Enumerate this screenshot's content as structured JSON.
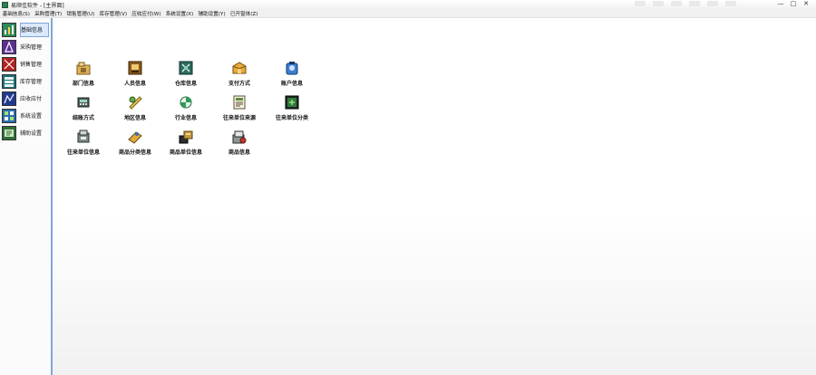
{
  "window": {
    "title": "易顺佳软件 - [主界面]",
    "controls": [
      "—",
      "□",
      "✕"
    ]
  },
  "menu": [
    "基础信息(S)",
    "采购管理(T)",
    "销售管理(U)",
    "库存管理(V)",
    "应收应付(W)",
    "系统设置(X)",
    "辅助设置(Y)",
    "已开窗体(Z)"
  ],
  "sidebar": {
    "items": [
      {
        "label": "基础信息",
        "icon": "folder-chart-icon",
        "active": true
      },
      {
        "label": "采购管理",
        "icon": "purchase-icon",
        "active": false
      },
      {
        "label": "销售管理",
        "icon": "sales-icon",
        "active": false
      },
      {
        "label": "库存管理",
        "icon": "inventory-icon",
        "active": false
      },
      {
        "label": "应收应付",
        "icon": "receivable-icon",
        "active": false
      },
      {
        "label": "系统设置",
        "icon": "settings-icon",
        "active": false
      },
      {
        "label": "辅助设置",
        "icon": "aux-settings-icon",
        "active": false
      }
    ]
  },
  "tiles": [
    {
      "label": "部门信息",
      "icon": "department-icon"
    },
    {
      "label": "人员信息",
      "icon": "staff-icon"
    },
    {
      "label": "仓库信息",
      "icon": "warehouse-icon"
    },
    {
      "label": "支付方式",
      "icon": "payment-icon"
    },
    {
      "label": "账户信息",
      "icon": "account-icon"
    },
    {
      "label": "结账方式",
      "icon": "settlement-icon"
    },
    {
      "label": "地区信息",
      "icon": "region-icon"
    },
    {
      "label": "行业信息",
      "icon": "industry-icon"
    },
    {
      "label": "往来单位来源",
      "icon": "partner-source-icon"
    },
    {
      "label": "往来单位分类",
      "icon": "partner-category-icon"
    },
    {
      "label": "往来单位信息",
      "icon": "partner-info-icon"
    },
    {
      "label": "商品分类信息",
      "icon": "product-category-icon"
    },
    {
      "label": "商品单位信息",
      "icon": "product-unit-icon"
    },
    {
      "label": "商品信息",
      "icon": "product-info-icon"
    }
  ]
}
